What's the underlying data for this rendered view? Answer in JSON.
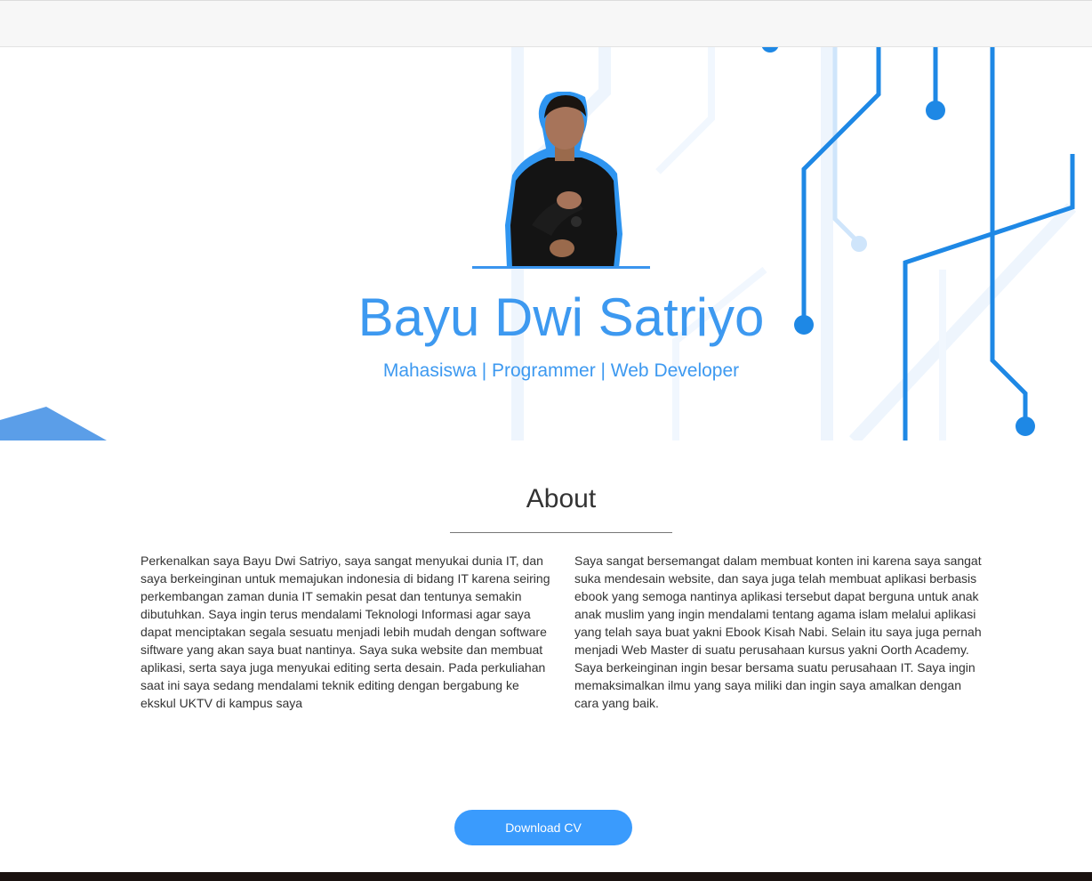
{
  "hero": {
    "name": "Bayu Dwi Satriyo",
    "tagline": "Mahasiswa | Programmer | Web Developer",
    "accent_color": "#3d99f0"
  },
  "about": {
    "title": "About",
    "left_text": "Perkenalkan saya Bayu Dwi Satriyo, saya sangat menyukai dunia IT, dan saya berkeinginan untuk memajukan indonesia di bidang IT karena seiring perkembangan zaman dunia IT semakin pesat dan tentunya semakin dibutuhkan. Saya ingin terus mendalami Teknologi Informasi agar saya dapat menciptakan segala sesuatu menjadi lebih mudah dengan software siftware yang akan saya buat nantinya. Saya suka website dan membuat aplikasi, serta saya juga menyukai editing serta desain. Pada perkuliahan saat ini saya sedang mendalami teknik editing dengan bergabung ke ekskul UKTV di kampus saya",
    "right_text": "Saya sangat bersemangat dalam membuat konten ini karena saya sangat suka mendesain website, dan saya juga telah membuat aplikasi berbasis ebook yang semoga nantinya aplikasi tersebut dapat berguna untuk anak anak muslim yang ingin mendalami tentang agama islam melalui aplikasi yang telah saya buat yakni Ebook Kisah Nabi. Selain itu saya juga pernah menjadi Web Master di suatu perusahaan kursus yakni Oorth Academy. Saya berkeinginan ingin besar bersama suatu perusahaan IT. Saya ingin memaksimalkan ilmu yang saya miliki dan ingin saya amalkan dengan cara yang baik."
  },
  "download": {
    "label": "Download CV",
    "color": "#3a9bfd"
  }
}
